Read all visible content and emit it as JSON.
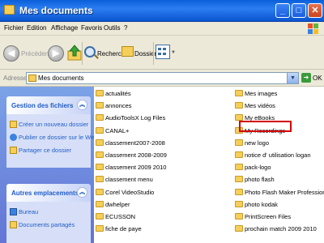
{
  "window": {
    "title": "Mes documents"
  },
  "menu": [
    "Fichier",
    "Edition",
    "Affichage",
    "Favoris",
    "Outils",
    "?"
  ],
  "toolbar": {
    "back_label": "Précédente",
    "search_label": "Rechercher",
    "folders_label": "Dossiers"
  },
  "address": {
    "label": "Adresse",
    "value": "Mes documents",
    "go_label": "OK"
  },
  "taskpane": {
    "file_tasks": {
      "title": "Gestion des fichiers",
      "items": [
        "Créer un nouveau dossier",
        "Publier ce dossier sur le Web",
        "Partager ce dossier"
      ]
    },
    "other_places": {
      "title": "Autres emplacements",
      "items": [
        "Bureau",
        "Documents partagés"
      ]
    }
  },
  "files": {
    "col1": [
      "actualités",
      "annonces",
      "AudioToolsX Log Files",
      "CANAL+",
      "classement2007-2008",
      "classement 2008-2009",
      "classement 2009 2010",
      "classement menu",
      "Corel VideoStudio",
      "dwhelper",
      "ECUSSON",
      "fiche de paye"
    ],
    "col2": [
      "Mes images",
      "Mes vidéos",
      "My eBooks",
      "My Recordings",
      "new logo",
      "notice d' utilisation logan",
      "pack-logo",
      "photo flash",
      "Photo Flash Maker Professional",
      "photo kodak",
      "PrintScreen Files",
      "prochain match 2009 2010"
    ],
    "highlighted": "My Recordings"
  },
  "colors": {
    "title_bar": "#0a5fd8",
    "task_pane": "#7ba2e7",
    "highlight": "#d40000",
    "folder": "#f5cf5a"
  },
  "icons": [
    "folder-icon",
    "back-icon",
    "forward-icon",
    "up-folder-icon",
    "search-icon",
    "folders-icon",
    "views-icon",
    "go-icon",
    "windows-logo-icon"
  ]
}
